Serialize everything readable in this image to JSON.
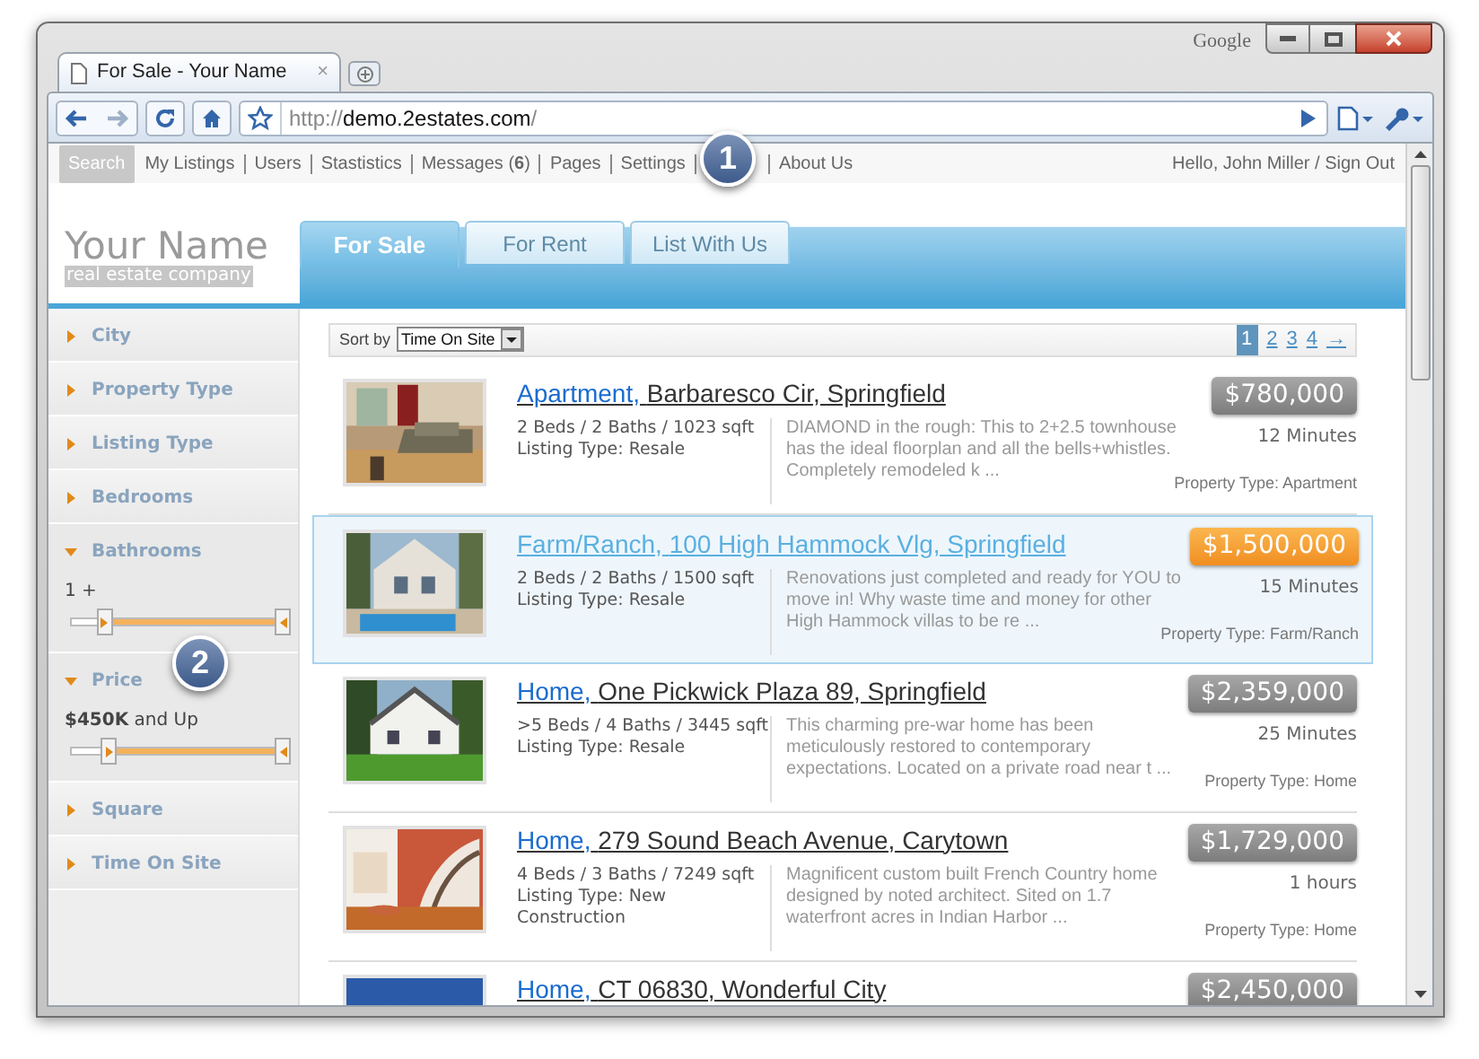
{
  "browser": {
    "tab_title": "For Sale - Your Name",
    "tab_close": "×",
    "brand": "Google",
    "url_prefix": "http://",
    "url_host": "demo.2estates.com",
    "url_suffix": "/"
  },
  "admin_bar": {
    "search": "Search",
    "links": [
      "My Listings",
      "Users",
      "Stastistics",
      "Messages (**6**)",
      "Pages",
      "Settings"
    ],
    "links_after": [
      "About Us"
    ],
    "greeting": "Hello, John Miller / Sign Out"
  },
  "callouts": [
    "1",
    "2"
  ],
  "site": {
    "logo": "Your Name",
    "tagline": "real estate company"
  },
  "tabs": [
    {
      "label": "For Sale",
      "selected": true
    },
    {
      "label": "For Rent",
      "selected": false
    },
    {
      "label": "List With Us",
      "selected": false
    }
  ],
  "filters": [
    {
      "label": "City",
      "expanded": false
    },
    {
      "label": "Property Type",
      "expanded": false
    },
    {
      "label": "Listing Type",
      "expanded": false
    },
    {
      "label": "Bedrooms",
      "expanded": false
    },
    {
      "label": "Bathrooms",
      "expanded": true,
      "value": "1 +",
      "level": 0.82
    },
    {
      "label": "Price",
      "expanded": true,
      "value": "**$450K** and Up",
      "level": 0.8
    },
    {
      "label": "Square",
      "expanded": false
    },
    {
      "label": "Time On Site",
      "expanded": false
    }
  ],
  "sort": {
    "label": "Sort by",
    "value": "Time On Site"
  },
  "pages": [
    {
      "label": "1",
      "selected": true
    },
    {
      "label": "2",
      "selected": false
    },
    {
      "label": "3",
      "selected": false
    },
    {
      "label": "4",
      "selected": false
    },
    {
      "label": "→",
      "selected": false
    }
  ],
  "listings": [
    {
      "type": "Apartment,",
      "address": "Barbaresco Cir, Springfield",
      "specs": "2 Beds / 2 Baths / 1023 sqft",
      "listing_type": "Listing Type: Resale",
      "description": "DIAMOND in the rough: This to 2+2.5 townhouse has the ideal floorplan and all the bells+whistles. Completely remodeled k ...",
      "price": "$780,000",
      "time": "12 Minutes",
      "property_type": "Property Type: Apartment",
      "selected": false
    },
    {
      "type": "Farm/Ranch,",
      "address": "100 High Hammock Vlg, Springfield",
      "specs": "2 Beds / 2 Baths / 1500 sqft",
      "listing_type": "Listing Type: Resale",
      "description": "Renovations just completed and ready for YOU to move in! Why waste time and money for other High Hammock villas to be re ...",
      "price": "$1,500,000",
      "time": "15 Minutes",
      "property_type": "Property Type: Farm/Ranch",
      "selected": true
    },
    {
      "type": "Home,",
      "address": "One Pickwick Plaza 89, Springfield",
      "specs": ">5 Beds / 4 Baths / 3445 sqft",
      "listing_type": "Listing Type: Resale",
      "description": "This charming pre-war home has been meticulously restored to contemporary expectations. Located on a private road near t ...",
      "price": "$2,359,000",
      "time": "25 Minutes",
      "property_type": "Property Type: Home",
      "selected": false
    },
    {
      "type": "Home,",
      "address": "279 Sound Beach Avenue, Carytown",
      "specs": "4 Beds / 3 Baths / 7249 sqft",
      "listing_type": "Listing Type: New Construction",
      "description": "Magnificent custom built French Country home designed by noted architect. Sited on 1.7 waterfront acres in Indian Harbor ...",
      "price": "$1,729,000",
      "time": "1 hours",
      "property_type": "Property Type: Home",
      "selected": false
    },
    {
      "type": "Home,",
      "address": "CT 06830, Wonderful City",
      "price": "$2,450,000",
      "selected": false
    }
  ]
}
